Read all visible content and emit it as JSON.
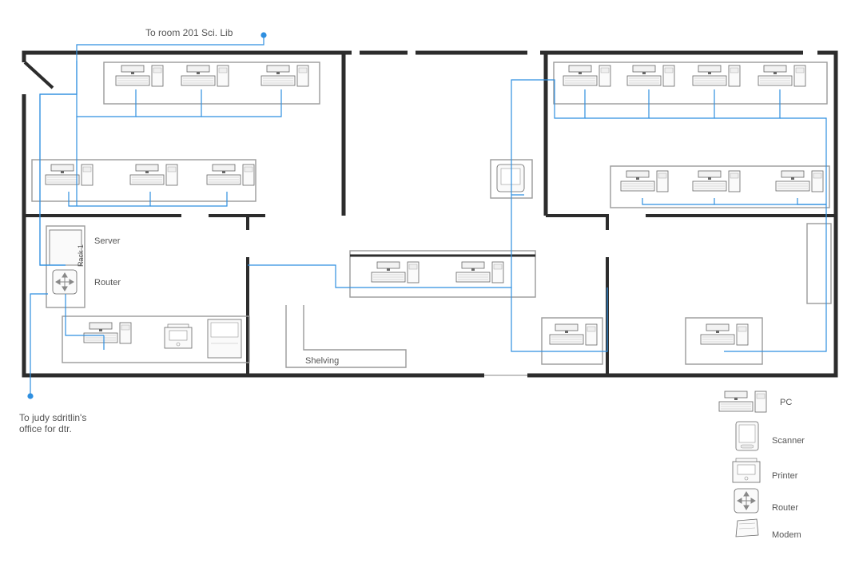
{
  "annotations": {
    "to_room_201": "To room 201 Sci. Lib",
    "to_judy": "To judy sdritlin's\noffice for dtr."
  },
  "devices": {
    "server": "Server",
    "router": "Router",
    "rack1": "Rack 1",
    "shelving": "Shelving"
  },
  "legend": {
    "pc": "PC",
    "scanner": "Scanner",
    "printer": "Printer",
    "router": "Router",
    "modem": "Modem"
  },
  "colors": {
    "wall": "#2c2c2c",
    "cable": "#2f8fe0",
    "dot": "#2f8fe0",
    "equip_fill": "#f8f8f8",
    "equip_stroke": "#7a7a7a"
  }
}
